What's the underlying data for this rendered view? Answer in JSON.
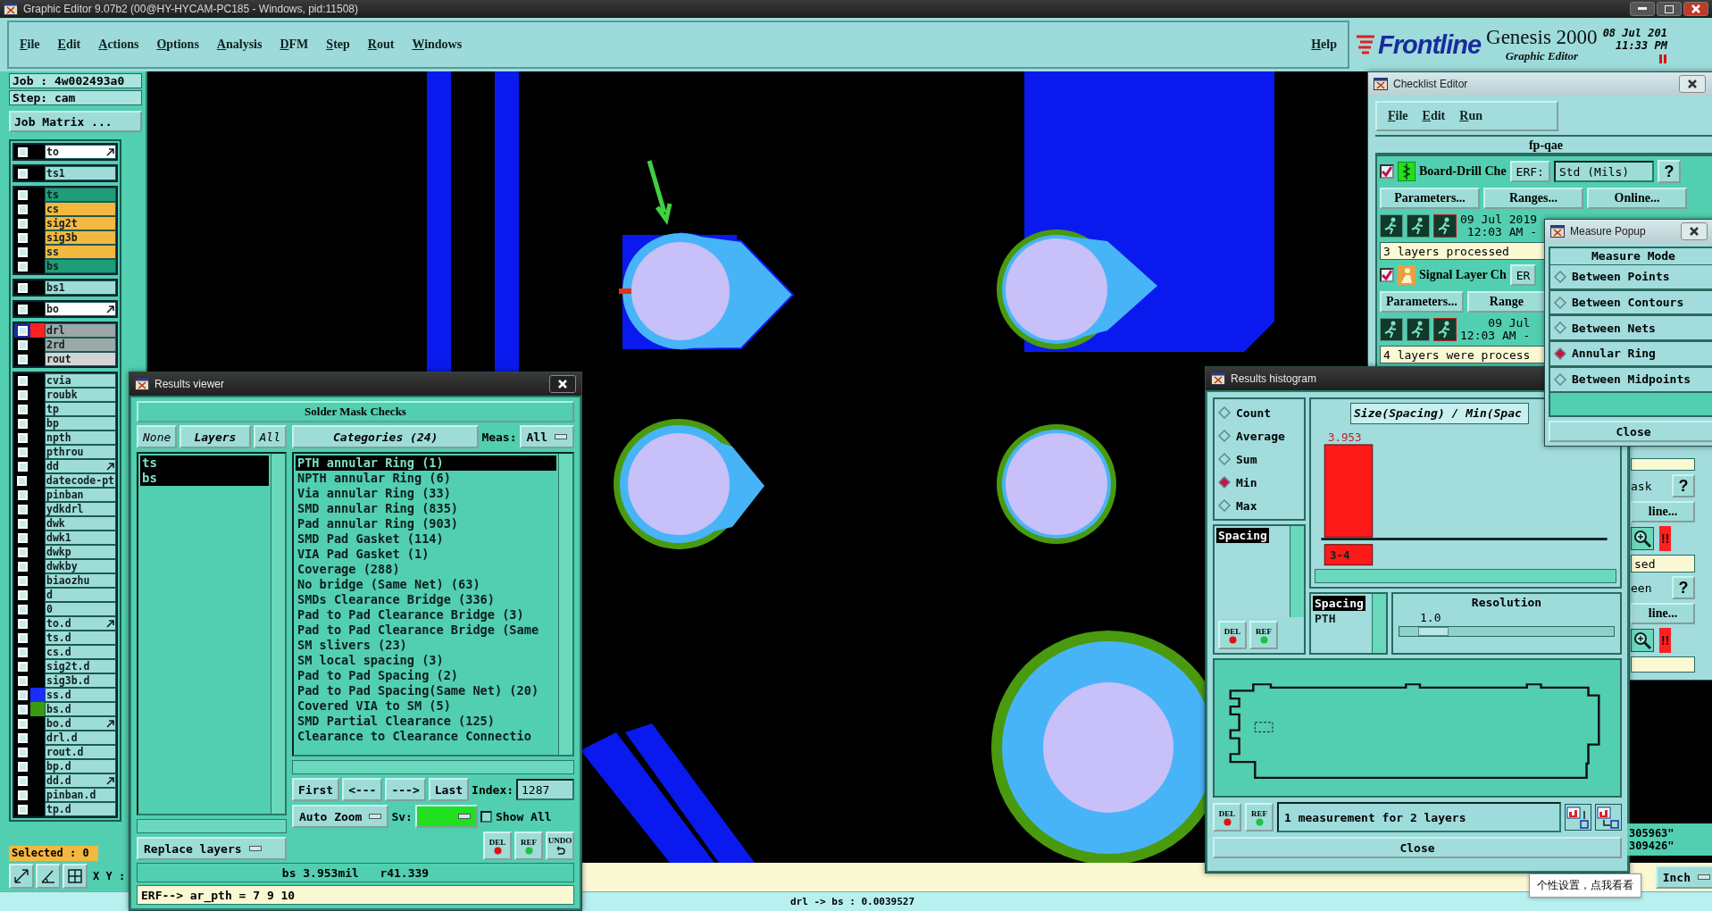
{
  "window": {
    "title": "Graphic Editor 9.07b2 (00@HY-HYCAM-PC185 - Windows, pid:11508)"
  },
  "menu": {
    "items": [
      "File",
      "Edit",
      "Actions",
      "Options",
      "Analysis",
      "DFM",
      "Step",
      "Rout",
      "Windows"
    ],
    "help": "Help"
  },
  "branding": {
    "logo": "Frontline",
    "product": "Genesis 2000",
    "subtitle": "Graphic Editor",
    "date": "08 Jul 201",
    "time": "11:33 PM"
  },
  "job": {
    "job": "Job : 4w002493a0",
    "step": "Step: cam",
    "matrix_button": "Job Matrix ..."
  },
  "layer_groups": [
    {
      "layers": [
        {
          "name": "to",
          "kind": "outline",
          "linked": true,
          "selected": false
        }
      ]
    },
    {
      "layers": [
        {
          "name": "ts1",
          "kind": "misc",
          "linked": false,
          "selected": false
        }
      ]
    },
    {
      "layers": [
        {
          "name": "ts",
          "kind": "mask",
          "linked": false,
          "selected": false
        },
        {
          "name": "cs",
          "kind": "signal",
          "linked": false,
          "selected": false
        },
        {
          "name": "sig2t",
          "kind": "signal",
          "linked": false,
          "selected": false
        },
        {
          "name": "sig3b",
          "kind": "signal",
          "linked": false,
          "selected": false
        },
        {
          "name": "ss",
          "kind": "signal",
          "linked": false,
          "selected": false
        },
        {
          "name": "bs",
          "kind": "mask",
          "linked": false,
          "selected": false
        }
      ]
    },
    {
      "layers": [
        {
          "name": "bs1",
          "kind": "misc",
          "linked": false,
          "selected": false
        }
      ]
    },
    {
      "layers": [
        {
          "name": "bo",
          "kind": "outline",
          "linked": true,
          "selected": false
        }
      ]
    },
    {
      "layers": [
        {
          "name": "drl",
          "kind": "drill",
          "color": "#ff2020",
          "linked": false,
          "selected": true
        },
        {
          "name": "2rd",
          "kind": "drill",
          "linked": false,
          "selected": false
        },
        {
          "name": "rout",
          "kind": "rout",
          "linked": false,
          "selected": false
        }
      ]
    },
    {
      "layers": [
        {
          "name": "cvia",
          "kind": "misc",
          "linked": false,
          "selected": false
        },
        {
          "name": "roubk",
          "kind": "misc",
          "linked": false,
          "selected": false
        },
        {
          "name": "tp",
          "kind": "misc",
          "linked": false,
          "selected": false
        },
        {
          "name": "bp",
          "kind": "misc",
          "linked": false,
          "selected": false
        },
        {
          "name": "npth",
          "kind": "misc",
          "linked": false,
          "selected": false
        },
        {
          "name": "pthrou",
          "kind": "misc",
          "linked": false,
          "selected": false
        },
        {
          "name": "dd",
          "kind": "misc",
          "linked": true,
          "selected": false
        },
        {
          "name": "datecode-pt",
          "kind": "misc",
          "linked": false,
          "selected": false
        },
        {
          "name": "pinban",
          "kind": "misc",
          "linked": false,
          "selected": false
        },
        {
          "name": "ydkdrl",
          "kind": "misc",
          "linked": false,
          "selected": false
        },
        {
          "name": "dwk",
          "kind": "misc",
          "linked": false,
          "selected": false
        },
        {
          "name": "dwk1",
          "kind": "misc",
          "linked": false,
          "selected": false
        },
        {
          "name": "dwkp",
          "kind": "misc",
          "linked": false,
          "selected": false
        },
        {
          "name": "dwkby",
          "kind": "misc",
          "linked": false,
          "selected": false
        },
        {
          "name": "biaozhu",
          "kind": "misc",
          "linked": false,
          "selected": false
        },
        {
          "name": "d",
          "kind": "misc",
          "linked": false,
          "selected": false
        },
        {
          "name": "0",
          "kind": "misc",
          "linked": false,
          "selected": false
        },
        {
          "name": "to.d",
          "kind": "misc",
          "linked": true,
          "selected": false
        },
        {
          "name": "ts.d",
          "kind": "misc",
          "linked": false,
          "selected": false
        },
        {
          "name": "cs.d",
          "kind": "misc",
          "linked": false,
          "selected": false
        },
        {
          "name": "sig2t.d",
          "kind": "misc",
          "linked": false,
          "selected": false
        },
        {
          "name": "sig3b.d",
          "kind": "misc",
          "linked": false,
          "selected": false
        },
        {
          "name": "ss.d",
          "kind": "misc",
          "color": "#1a2cff",
          "linked": false,
          "selected": false
        },
        {
          "name": "bs.d",
          "kind": "misc",
          "color": "#3a9a10",
          "linked": false,
          "selected": false
        },
        {
          "name": "bo.d",
          "kind": "misc",
          "linked": true,
          "selected": false
        },
        {
          "name": "drl.d",
          "kind": "misc",
          "linked": false,
          "selected": false
        },
        {
          "name": "rout.d",
          "kind": "misc",
          "linked": false,
          "selected": false
        },
        {
          "name": "bp.d",
          "kind": "misc",
          "linked": false,
          "selected": false
        },
        {
          "name": "dd.d",
          "kind": "misc",
          "linked": true,
          "selected": false
        },
        {
          "name": "pinban.d",
          "kind": "misc",
          "linked": false,
          "selected": false
        },
        {
          "name": "tp.d",
          "kind": "misc",
          "linked": false,
          "selected": false
        }
      ]
    }
  ],
  "selected_count": "Selected : 0",
  "xy_label": "X Y :",
  "results_viewer": {
    "title": "Results viewer",
    "heading": "Solder Mask Checks",
    "layer_buttons": [
      "None",
      "Layers",
      "All"
    ],
    "layers": [
      {
        "name": "ts",
        "selected": true
      },
      {
        "name": "bs",
        "selected": true
      }
    ],
    "categories_button": "Categories (24)",
    "meas_label": "Meas:",
    "meas_value": "All",
    "categories": [
      {
        "name": "PTH annular Ring (1)",
        "selected": true
      },
      {
        "name": "NPTH annular Ring (6)",
        "selected": false
      },
      {
        "name": "Via annular Ring (33)",
        "selected": false
      },
      {
        "name": "SMD annular Ring (835)",
        "selected": false
      },
      {
        "name": "Pad annular Ring (903)",
        "selected": false
      },
      {
        "name": "SMD Pad Gasket (114)",
        "selected": false
      },
      {
        "name": "VIA Pad Gasket (1)",
        "selected": false
      },
      {
        "name": "Coverage (288)",
        "selected": false
      },
      {
        "name": "No bridge (Same Net) (63)",
        "selected": false
      },
      {
        "name": "SMDs Clearance Bridge (336)",
        "selected": false
      },
      {
        "name": "Pad to Pad Clearance Bridge (3)",
        "selected": false
      },
      {
        "name": "Pad to Pad Clearance Bridge (Same",
        "selected": false
      },
      {
        "name": "SM slivers (23)",
        "selected": false
      },
      {
        "name": "SM local spacing (3)",
        "selected": false
      },
      {
        "name": "Pad to Pad Spacing (2)",
        "selected": false
      },
      {
        "name": "Pad to Pad Spacing(Same Net) (20)",
        "selected": false
      },
      {
        "name": "Covered VIA to SM (5)",
        "selected": false
      },
      {
        "name": "SMD Partial Clearance (125)",
        "selected": false
      },
      {
        "name": "Clearance to Clearance Connectio",
        "selected": false
      }
    ],
    "nav_buttons": [
      "First",
      "<---",
      "--->",
      "Last"
    ],
    "index_label": "Index:",
    "index_value": "1287",
    "zoom_mode": "Auto Zoom",
    "sv_label": "Sv:",
    "show_all": {
      "label": "Show All",
      "checked": false
    },
    "replace_mode": "Replace layers",
    "tool_buttons": [
      "DEL",
      "REF",
      "UNDO"
    ],
    "measurement": "bs 3.953mil   r41.339",
    "erf_line": "ERF--> ar_pth = 7 9 10"
  },
  "checklist_editor": {
    "title": "Checklist Editor",
    "menu": [
      "File",
      "Edit",
      "Run"
    ],
    "name": "fp-qae",
    "items": [
      {
        "checked": true,
        "kind": "drill",
        "name": "Board-Drill Che",
        "erf": "ERF:",
        "erf_value": "Std (Mils)",
        "help": "?",
        "buttons": [
          "Parameters...",
          "Ranges...",
          "Online..."
        ],
        "date": "09 Jul 2019",
        "time": "12:03 AM -",
        "status": "3 layers processed"
      },
      {
        "checked": true,
        "kind": "signal",
        "name": "Signal Layer Ch",
        "erf": "ER",
        "buttons": [
          "Parameters...",
          "Range"
        ],
        "date": "09 Jul",
        "time": "12:03 AM -",
        "status": "4 layers were process"
      }
    ],
    "partial_items": [
      {
        "erf": "ask",
        "help": "?",
        "button": "line...",
        "alert": "!!",
        "status": "sed"
      },
      {
        "erf": "een",
        "help": "?",
        "button": "line...",
        "alert": "!!"
      }
    ]
  },
  "measure_popup": {
    "title": "Measure Popup",
    "heading": "Measure Mode",
    "modes": [
      {
        "label": "Between Points",
        "selected": false
      },
      {
        "label": "Between Contours",
        "selected": false
      },
      {
        "label": "Between Nets",
        "selected": false
      },
      {
        "label": "Annular Ring",
        "selected": true
      },
      {
        "label": "Between Midpoints",
        "selected": false
      }
    ],
    "close": "Close"
  },
  "histogram": {
    "title": "Results histogram",
    "stats": [
      {
        "label": "Count",
        "selected": false
      },
      {
        "label": "Average",
        "selected": false
      },
      {
        "label": "Sum",
        "selected": false
      },
      {
        "label": "Min",
        "selected": true
      },
      {
        "label": "Max",
        "selected": false
      }
    ],
    "measures": [
      {
        "name": "Spacing",
        "selected": true
      }
    ],
    "tool_buttons": [
      "DEL",
      "REF"
    ],
    "chart_title": "Size(Spacing) / Min(Spac",
    "bins": [
      {
        "label": "3-4",
        "value_label": "3.953"
      }
    ],
    "types": [
      {
        "name": "Spacing",
        "selected": true
      },
      {
        "name": "PTH",
        "selected": false
      }
    ],
    "resolution": {
      "label": "Resolution",
      "value": "1.0",
      "level": 0.1
    },
    "summary_buttons": [
      "DEL",
      "REF"
    ],
    "summary": "1 measurement for 2 layers",
    "close": "Close"
  },
  "coordinates": [
    "305963\"",
    "309426\""
  ],
  "units": "Inch",
  "tooltip": "个性设置，点我看看",
  "status": "drl -> bs : 0.0039527"
}
